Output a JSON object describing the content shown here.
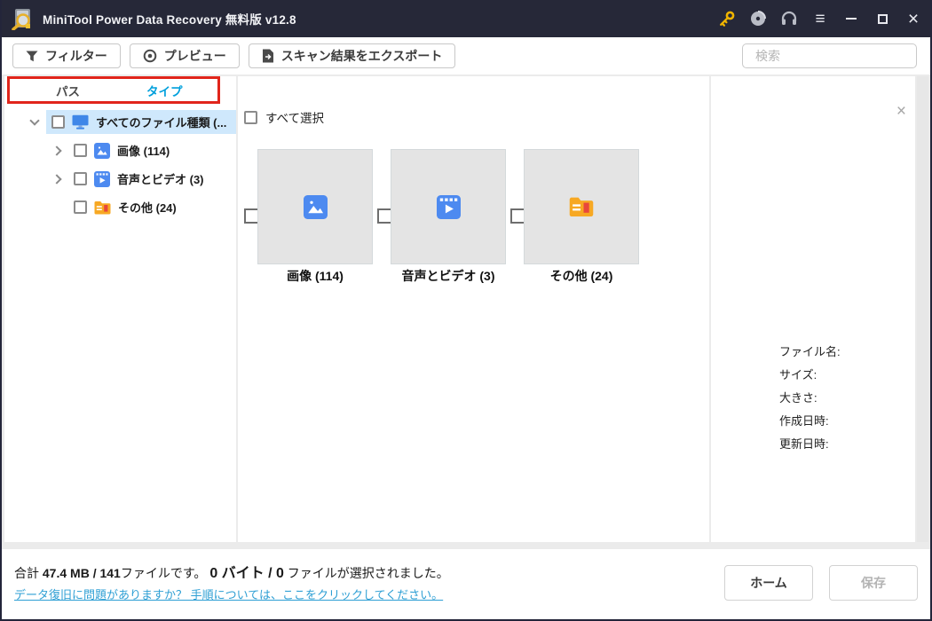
{
  "titlebar": {
    "title": "MiniTool Power Data Recovery 無料版 v12.8",
    "menu_glyph": "≡",
    "close_glyph": "×"
  },
  "toolbar": {
    "filter": "フィルター",
    "preview": "プレビュー",
    "export": "スキャン結果をエクスポート",
    "search_placeholder": "検索"
  },
  "tabs": {
    "path": "パス",
    "type": "タイプ"
  },
  "tree": [
    {
      "label": "すべてのファイル種類 (...",
      "icon": "all-file-types-monitor",
      "expanded": true,
      "selected": true
    },
    {
      "label": "画像 (114)",
      "icon": "image",
      "expanded": false
    },
    {
      "label": "音声とビデオ (3)",
      "icon": "audio-video",
      "expanded": false
    },
    {
      "label": "その他 (24)",
      "icon": "other-folder"
    }
  ],
  "content": {
    "select_all": "すべて選択",
    "tiles": [
      {
        "label": "画像 (114)",
        "icon": "image"
      },
      {
        "label": "音声とビデオ (3)",
        "icon": "audio-video"
      },
      {
        "label": "その他 (24)",
        "icon": "other-folder"
      }
    ]
  },
  "details": {
    "close_glyph": "×",
    "file_name": "ファイル名:",
    "size": "サイズ:",
    "dimensions": "大きさ:",
    "created": "作成日時:",
    "modified": "更新日時:"
  },
  "statusbar": {
    "total_prefix": "合計 ",
    "total_value": "47.4 MB / 141",
    "total_suffix": "ファイルです。 ",
    "selected_value": "0 バイト / 0",
    "selected_suffix": " ファイルが選択されました。",
    "help_link": "データ復旧に問題がありますか？ 手順については、ここをクリックしてください。",
    "home": "ホーム",
    "save": "保存"
  },
  "colors": {
    "titlebar_bg": "#262838",
    "accent_blue": "#00a0dc",
    "tree_highlight": "#cfe8fc",
    "icon_blue": "#4d8af0",
    "folder_orange": "#f7a823",
    "link_blue": "#2e9fd4",
    "annotation_red": "#e1251b",
    "key_gold": "#f0b400"
  }
}
